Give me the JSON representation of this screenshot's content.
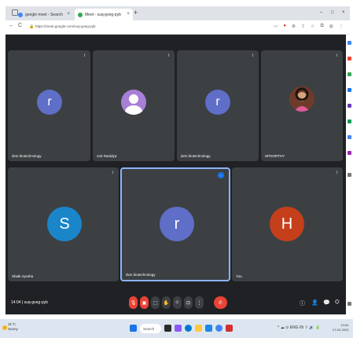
{
  "browser": {
    "tabs": [
      {
        "label": "google meet - Search",
        "close": "×"
      },
      {
        "label": "Meet - suq-gveg-pyb",
        "close": "×"
      }
    ],
    "new_tab": "+",
    "window_controls": [
      "–",
      "□",
      "×"
    ],
    "url": "https://meet.google.com/suq-gveg-pyb",
    "nav": [
      "←",
      "C"
    ]
  },
  "meet": {
    "tiles": [
      {
        "name": "dvm biotechnology",
        "initial": "r",
        "avatar_color": "#5f6ec7"
      },
      {
        "name": "442 Ranidya",
        "initial": "",
        "avatar_color": "#a77fd6"
      },
      {
        "name": "dvm biotechnology",
        "initial": "r",
        "avatar_color": "#5f6ec7"
      },
      {
        "name": "SPOORTHY",
        "initial": "",
        "avatar_color": "#7b2a2a"
      },
      {
        "name": "Shaik Ayesha",
        "initial": "S",
        "avatar_color": "#1a86c9"
      },
      {
        "name": "dvm biotechnology",
        "initial": "r",
        "avatar_color": "#5f6ec7"
      },
      {
        "name": "You",
        "initial": "H",
        "avatar_color": "#c53f1b"
      }
    ],
    "mic_glyph": "⌇",
    "pin_glyph": "⋯"
  },
  "bottombar": {
    "time_code": "14:04 | suq-gveg-pyb",
    "controls": [
      "🎙",
      "▣",
      "⬚",
      "✋",
      "☺",
      "⊡",
      "⋮"
    ],
    "end_call": "✆",
    "right_controls": [
      "ⓘ",
      "👤",
      "💬",
      "⛭"
    ]
  },
  "taskbar": {
    "weather_temp": "31°C",
    "weather_desc": "Sunny",
    "search_label": "Search",
    "tray_text": "^ ☁ ⊙ ENG IN ⌔ 🔊 🔋",
    "clock_time": "14:04",
    "clock_date": "27-02-2023"
  },
  "colors": {
    "meet_bg": "#202124",
    "tile_bg": "#3c4043",
    "active_border": "#8ab4f8",
    "end_call": "#ea4335"
  }
}
